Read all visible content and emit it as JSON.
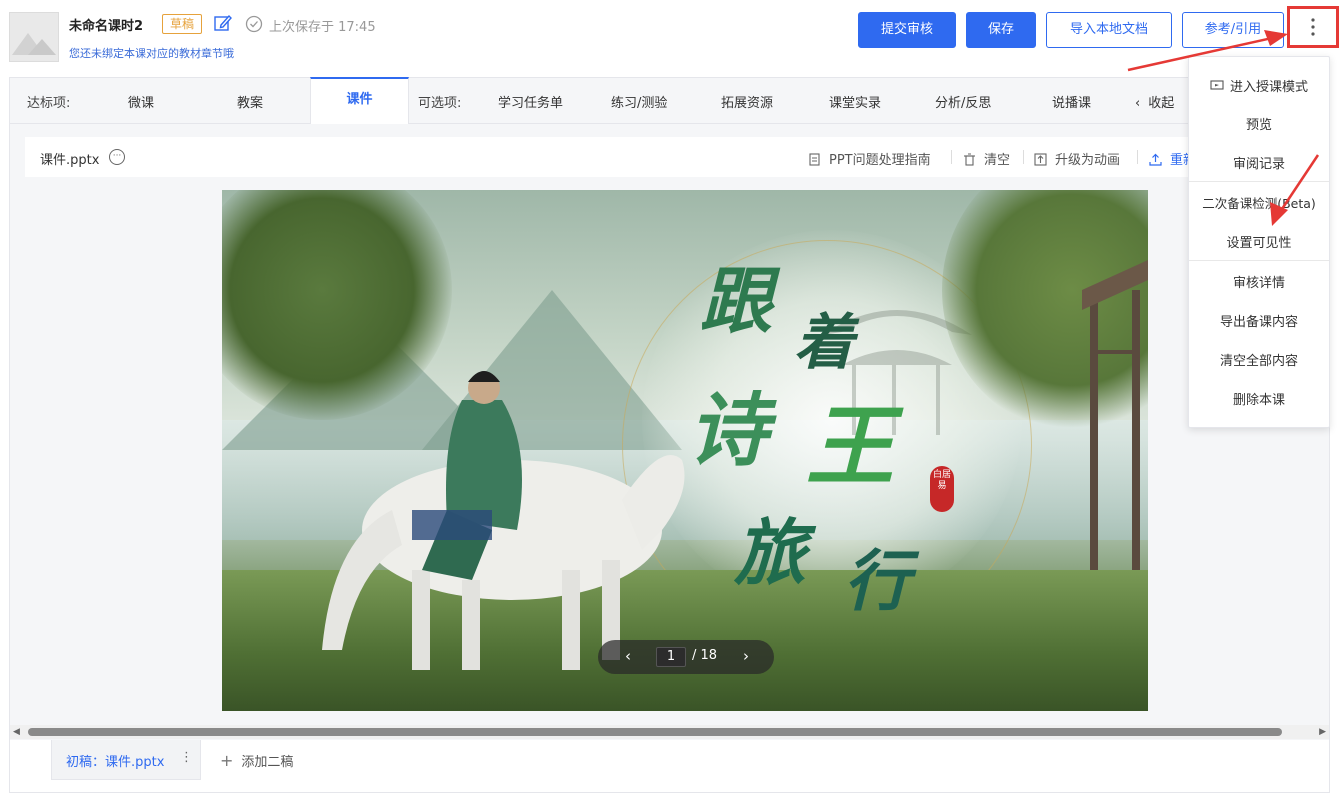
{
  "header": {
    "course_title": "未命名课时2",
    "draft_badge": "草稿",
    "save_status": "上次保存于 17:45",
    "bind_hint": "您还未绑定本课对应的教材章节哦",
    "buttons": {
      "submit_review": "提交审核",
      "save": "保存",
      "import_local": "导入本地文档",
      "reference": "参考/引用"
    }
  },
  "tabs": {
    "required_label": "达标项:",
    "required": [
      "微课",
      "教案",
      "课件"
    ],
    "active": "课件",
    "optional_label": "可选项:",
    "optional": [
      "学习任务单",
      "练习/测验",
      "拓展资源",
      "课堂实录",
      "分析/反思",
      "说播课"
    ],
    "collapse": "收起"
  },
  "file_bar": {
    "file_name": "课件.pptx",
    "tools": [
      "PPT问题处理指南",
      "清空",
      "升级为动画",
      "重新"
    ]
  },
  "slide": {
    "title_chars": [
      "跟",
      "着",
      "诗",
      "王",
      "旅",
      "行"
    ],
    "seal_text": "白居易",
    "current_page": "1",
    "total_pages": "/ 18"
  },
  "drafts": {
    "first_draft": "初稿：课件.pptx",
    "add_draft": "添加二稿"
  },
  "menu": {
    "items": [
      "进入授课模式",
      "预览",
      "审阅记录",
      "二次备课检测(Beta)",
      "设置可见性",
      "审核详情",
      "导出备课内容",
      "清空全部内容",
      "删除本课"
    ]
  },
  "colors": {
    "accent": "#2f6af0",
    "draft_badge": "#e6a23c",
    "annotation_red": "#e53935"
  }
}
